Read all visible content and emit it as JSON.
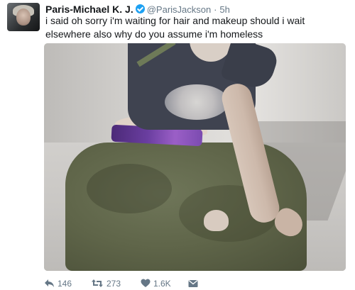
{
  "tweet": {
    "author": {
      "display_name": "Paris-Michael K. J.",
      "handle": "@ParisJackson",
      "verified": true
    },
    "separator": "·",
    "time": "5h",
    "text": "i said oh sorry i'm waiting for hair and makeup should i wait elsewhere also why do you assume i'm homeless",
    "actions": {
      "reply_count": "146",
      "retweet_count": "273",
      "like_count": "1.6K"
    }
  },
  "colors": {
    "text": "#14171a",
    "secondary": "#657786",
    "verified_badge": "#1da1f2"
  },
  "icons": [
    "reply-icon",
    "retweet-icon",
    "heart-icon",
    "envelope-icon",
    "verified-badge-icon"
  ]
}
